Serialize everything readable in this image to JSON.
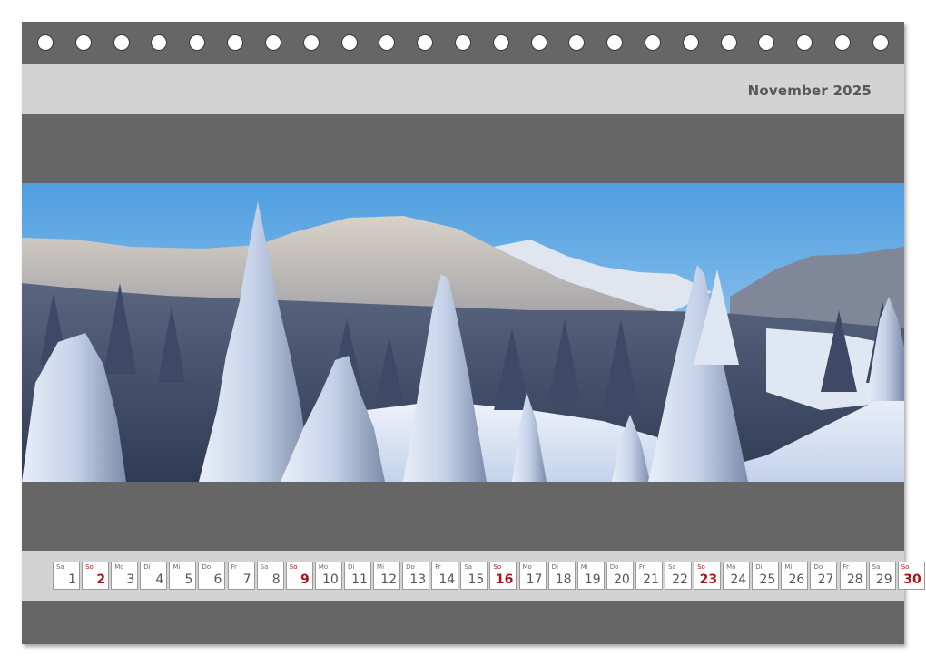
{
  "calendar": {
    "month_title": "November 2025",
    "colors": {
      "page": "#666666",
      "band": "#d3d3d3",
      "sunday": "#b01212",
      "text": "#555555"
    },
    "days": [
      {
        "dow": "Sa",
        "num": "1"
      },
      {
        "dow": "So",
        "num": "2",
        "sunday": true
      },
      {
        "dow": "Mo",
        "num": "3"
      },
      {
        "dow": "Di",
        "num": "4"
      },
      {
        "dow": "Mi",
        "num": "5"
      },
      {
        "dow": "Do",
        "num": "6"
      },
      {
        "dow": "Fr",
        "num": "7"
      },
      {
        "dow": "Sa",
        "num": "8"
      },
      {
        "dow": "So",
        "num": "9",
        "sunday": true
      },
      {
        "dow": "Mo",
        "num": "10"
      },
      {
        "dow": "Di",
        "num": "11"
      },
      {
        "dow": "Mi",
        "num": "12"
      },
      {
        "dow": "Do",
        "num": "13"
      },
      {
        "dow": "Fr",
        "num": "14"
      },
      {
        "dow": "Sa",
        "num": "15"
      },
      {
        "dow": "So",
        "num": "16",
        "sunday": true
      },
      {
        "dow": "Mo",
        "num": "17"
      },
      {
        "dow": "Di",
        "num": "18"
      },
      {
        "dow": "Mi",
        "num": "19"
      },
      {
        "dow": "Do",
        "num": "20"
      },
      {
        "dow": "Fr",
        "num": "21"
      },
      {
        "dow": "Sa",
        "num": "22"
      },
      {
        "dow": "So",
        "num": "23",
        "sunday": true
      },
      {
        "dow": "Mo",
        "num": "24"
      },
      {
        "dow": "Di",
        "num": "25"
      },
      {
        "dow": "Mi",
        "num": "26"
      },
      {
        "dow": "Do",
        "num": "27"
      },
      {
        "dow": "Fr",
        "num": "28"
      },
      {
        "dow": "Sa",
        "num": "29"
      },
      {
        "dow": "So",
        "num": "30",
        "sunday": true
      }
    ]
  }
}
